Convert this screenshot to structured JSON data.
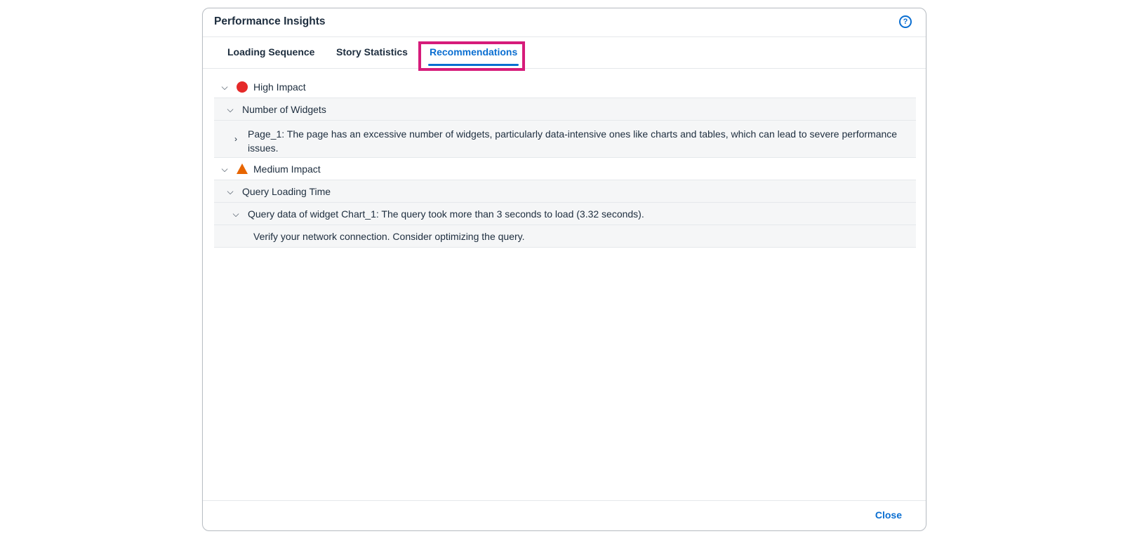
{
  "dialog": {
    "title": "Performance Insights",
    "help_icon": "question-circle-icon",
    "close_label": "Close"
  },
  "tabs": [
    {
      "label": "Loading Sequence",
      "selected": false
    },
    {
      "label": "Story Statistics",
      "selected": false
    },
    {
      "label": "Recommendations",
      "selected": true
    }
  ],
  "tree": {
    "high": {
      "label": "High Impact",
      "icon": "red-circle-icon",
      "category": "Number of Widgets",
      "item": "Page_1: The page has an excessive number of widgets, particularly data-intensive ones like charts and tables, which can lead to severe performance issues."
    },
    "medium": {
      "label": "Medium Impact",
      "icon": "orange-triangle-icon",
      "category": "Query Loading Time",
      "item": "Query data of widget Chart_1: The query took more than 3 seconds to load (3.32 seconds).",
      "detail": "Verify your network connection. Consider optimizing the query."
    }
  },
  "colors": {
    "accent": "#0a6ed1",
    "highlight": "#d61b7a",
    "high_impact": "#e52929",
    "medium_impact": "#e76500"
  }
}
